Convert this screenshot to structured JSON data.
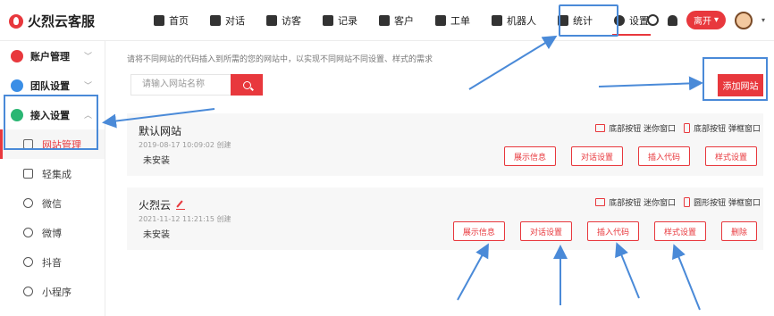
{
  "app": {
    "brand_name": "火烈云客服",
    "brand_color": "#e8383d",
    "annotation_color": "#4a8ad8"
  },
  "nav": {
    "items": [
      {
        "label": "首页",
        "icon": "home-icon"
      },
      {
        "label": "对话",
        "icon": "chat-icon"
      },
      {
        "label": "访客",
        "icon": "visitors-icon"
      },
      {
        "label": "记录",
        "icon": "records-icon"
      },
      {
        "label": "客户",
        "icon": "customer-icon"
      },
      {
        "label": "工单",
        "icon": "ticket-icon"
      },
      {
        "label": "机器人",
        "icon": "robot-icon"
      },
      {
        "label": "统计",
        "icon": "chart-icon"
      },
      {
        "label": "设置",
        "icon": "gear-icon"
      }
    ],
    "active": "设置"
  },
  "topbar": {
    "status_label": "离开",
    "status_caret": "▾",
    "avatar_caret": "▾"
  },
  "sidebar": {
    "groups": [
      {
        "label": "账户管理",
        "icon": "account-icon",
        "chevron": "﹀"
      },
      {
        "label": "团队设置",
        "icon": "team-icon",
        "chevron": "﹀"
      },
      {
        "label": "接入设置",
        "icon": "access-icon",
        "chevron": "︿"
      }
    ],
    "items": [
      {
        "label": "网站管理",
        "icon": "website-icon",
        "active": true
      },
      {
        "label": "轻集成",
        "icon": "integration-icon"
      },
      {
        "label": "微信",
        "icon": "wechat-icon"
      },
      {
        "label": "微博",
        "icon": "weibo-icon"
      },
      {
        "label": "抖音",
        "icon": "douyin-icon"
      },
      {
        "label": "小程序",
        "icon": "miniprogram-icon"
      }
    ]
  },
  "main": {
    "hint": "请将不同网站的代码插入到所需的您的网站中，以实现不同网站不同设置、样式的需求",
    "search_placeholder": "请输入网站名称",
    "add_button": "添加网站",
    "sites": [
      {
        "name": "默认网站",
        "created": "2019-08-17 10:09:02 创建",
        "status": "未安装",
        "pc_style": "底部按钮 迷你窗口",
        "mobile_style": "底部按钮 弹框窗口",
        "buttons": [
          "展示信息",
          "对话设置",
          "插入代码",
          "样式设置"
        ]
      },
      {
        "name": "火烈云",
        "created": "2021-11-12 11:21:15 创建",
        "status": "未安装",
        "pc_style": "底部按钮 迷你窗口",
        "mobile_style": "圆形按钮 弹框窗口",
        "buttons": [
          "展示信息",
          "对话设置",
          "插入代码",
          "样式设置",
          "删除"
        ]
      }
    ]
  }
}
